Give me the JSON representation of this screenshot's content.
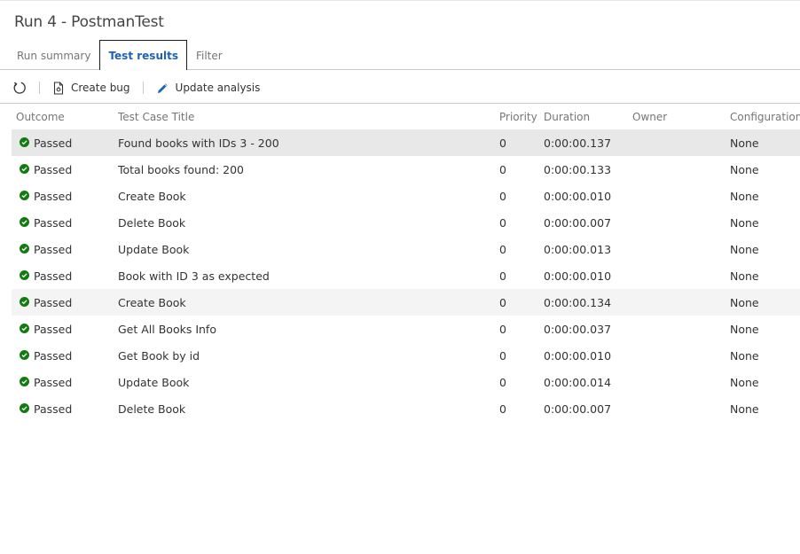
{
  "header": {
    "title": "Run 4 - PostmanTest"
  },
  "tabs": [
    {
      "label": "Run summary"
    },
    {
      "label": "Test results",
      "active": true
    },
    {
      "label": "Filter"
    }
  ],
  "toolbar": {
    "refresh_icon": "refresh-icon",
    "create_bug_label": "Create bug",
    "create_bug_icon": "bug-document-icon",
    "update_analysis_label": "Update analysis",
    "update_analysis_icon": "pencil-icon"
  },
  "columns": {
    "outcome": "Outcome",
    "title": "Test Case Title",
    "priority": "Priority",
    "duration": "Duration",
    "owner": "Owner",
    "configuration": "Configuration"
  },
  "colors": {
    "accent": "#1f62b4",
    "passed": "#107c10",
    "selected_row": "#e8e8e8"
  },
  "rows": [
    {
      "outcome": "Passed",
      "title": "Found books with IDs 3 - 200",
      "priority": "0",
      "duration": "0:00:00.137",
      "owner": "",
      "configuration": "None"
    },
    {
      "outcome": "Passed",
      "title": "Total books found: 200",
      "priority": "0",
      "duration": "0:00:00.133",
      "owner": "",
      "configuration": "None"
    },
    {
      "outcome": "Passed",
      "title": "Create Book",
      "priority": "0",
      "duration": "0:00:00.010",
      "owner": "",
      "configuration": "None"
    },
    {
      "outcome": "Passed",
      "title": "Delete Book",
      "priority": "0",
      "duration": "0:00:00.007",
      "owner": "",
      "configuration": "None"
    },
    {
      "outcome": "Passed",
      "title": "Update Book",
      "priority": "0",
      "duration": "0:00:00.013",
      "owner": "",
      "configuration": "None"
    },
    {
      "outcome": "Passed",
      "title": "Book with ID 3 as expected",
      "priority": "0",
      "duration": "0:00:00.010",
      "owner": "",
      "configuration": "None"
    },
    {
      "outcome": "Passed",
      "title": "Create Book",
      "priority": "0",
      "duration": "0:00:00.134",
      "owner": "",
      "configuration": "None"
    },
    {
      "outcome": "Passed",
      "title": "Get All Books Info",
      "priority": "0",
      "duration": "0:00:00.037",
      "owner": "",
      "configuration": "None"
    },
    {
      "outcome": "Passed",
      "title": "Get Book by id",
      "priority": "0",
      "duration": "0:00:00.010",
      "owner": "",
      "configuration": "None"
    },
    {
      "outcome": "Passed",
      "title": "Update Book",
      "priority": "0",
      "duration": "0:00:00.014",
      "owner": "",
      "configuration": "None"
    },
    {
      "outcome": "Passed",
      "title": "Delete Book",
      "priority": "0",
      "duration": "0:00:00.007",
      "owner": "",
      "configuration": "None"
    }
  ]
}
